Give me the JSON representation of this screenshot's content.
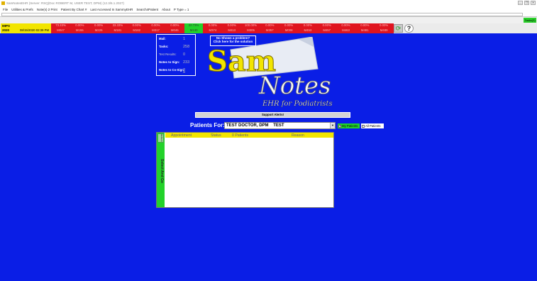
{
  "window": {
    "title": "SamNotesEHR (Server: RSQ(Doc ROBERT M, USER TEST, DPM) (12.3/6.1.2027)",
    "buttons": [
      "—",
      "❐",
      "✕"
    ]
  },
  "menu": [
    "File",
    "Utilities & Prefs",
    "Note(s) 2 Print",
    "Patient By Chart #",
    "Last Accessed In SammyEHR",
    "Search4Patient",
    "About",
    "P Type = 1"
  ],
  "toolbar": {
    "tasks_button": "Tasks(2)"
  },
  "mips": {
    "label": "MIPS",
    "year": "2020",
    "datetime": "08/15/2020 02:39 PM",
    "metrics": [
      {
        "top": "73.33%",
        "bottom": "M047",
        "color": "red"
      },
      {
        "top": "0.00%",
        "bottom": "M155",
        "color": "red"
      },
      {
        "top": "0.00%",
        "bottom": "M226",
        "color": "red"
      },
      {
        "top": "33.33%",
        "bottom": "M181",
        "color": "red"
      },
      {
        "top": "0.00%",
        "bottom": "M182",
        "color": "red"
      },
      {
        "top": "0.00%",
        "bottom": "M317",
        "color": "red"
      },
      {
        "top": "0.00%",
        "bottom": "M046",
        "color": "red"
      },
      {
        "top": "22.73%",
        "bottom": "M130",
        "color": "green"
      },
      {
        "top": "0.00%",
        "bottom": "M374",
        "color": "red"
      },
      {
        "top": "0.00%",
        "bottom": "M413",
        "color": "red"
      },
      {
        "top": "100.00%",
        "bottom": "M305",
        "color": "red"
      },
      {
        "top": "0.00%",
        "bottom": "M357",
        "color": "red"
      },
      {
        "top": "0.00%",
        "bottom": "M008",
        "color": "red"
      },
      {
        "top": "0.00%",
        "bottom": "M453",
        "color": "red"
      },
      {
        "top": "0.00%",
        "bottom": "M457",
        "color": "red"
      },
      {
        "top": "0.00%",
        "bottom": "M463",
        "color": "red"
      },
      {
        "top": "0.00%",
        "bottom": "M481",
        "color": "red"
      },
      {
        "top": "0.00%",
        "bottom": "M489",
        "color": "red"
      }
    ]
  },
  "stats": {
    "mail_label": "Mail:",
    "mail_value": "1",
    "tasks_label": "Tasks:",
    "tasks_value": "258",
    "test_label": "Test Results:",
    "test_value": "0",
    "sign_label": "Notes to Sign:",
    "sign_value": "233",
    "cosign_label": "Notes to Co-Sign:",
    "cosign_value": "3"
  },
  "noshow": {
    "line1": "No Shows a problem?",
    "line2": "Click here for the solution"
  },
  "logo": {
    "word1": "Sam",
    "word2": "Notes",
    "tagline": "EHR for Podiatrists"
  },
  "alerts_label": "Support Alerts!",
  "patients": {
    "label": "Patients For:",
    "selected_doctor": "TEST DOCTOR, DPM    TEST",
    "my_patients": "My Patients",
    "all_patients": "All Patients"
  },
  "appointments": {
    "refresh_label": "Refresh",
    "select_go": "Select And Go",
    "columns": [
      "Appointment",
      "Status",
      "0 Patients",
      "Reason"
    ]
  },
  "colors": {
    "background": "#0a1ee6",
    "mips_yellow": "#f2e500",
    "metric_red": "#e0141e",
    "metric_green": "#22d22a"
  }
}
